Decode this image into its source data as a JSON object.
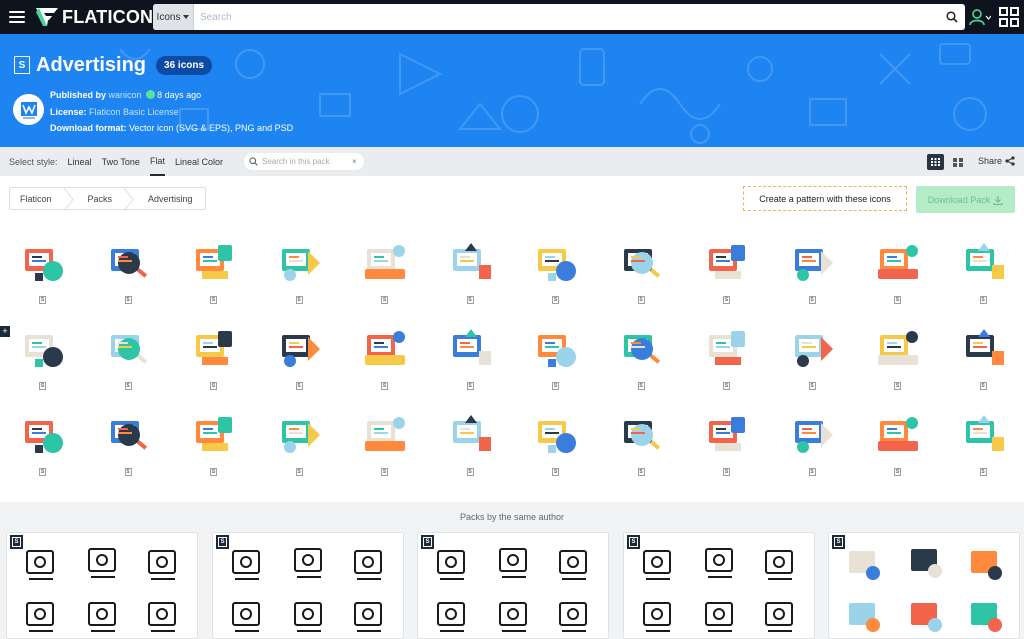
{
  "topbar": {
    "brand": "FLATICON",
    "search_select": "Icons",
    "search_placeholder": "Search"
  },
  "hero": {
    "title": "Advertising",
    "count": "36 icons",
    "published_label": "Published by",
    "author": "wanicon",
    "published_ago": "8 days ago",
    "license_label": "License:",
    "license_value": "Flaticon Basic License",
    "format_label": "Download format:",
    "format_value": "Vector icon (SVG & EPS), PNG and PSD"
  },
  "stylebar": {
    "label": "Select style:",
    "options": [
      "Lineal",
      "Two Tone",
      "Flat",
      "Lineal Color"
    ],
    "active": "Flat",
    "pack_search_placeholder": "Search in this pack",
    "share": "Share"
  },
  "breadcrumb": [
    "Flaticon",
    "Packs",
    "Advertising"
  ],
  "actions": {
    "pattern": "Create a pattern with these icons",
    "download": "Download Pack"
  },
  "icons": {
    "badge": "S",
    "rows": [
      [
        "monitor-ad",
        "search-person",
        "presenter-board",
        "newspapers",
        "chat-bubbles",
        "globe-speaker",
        "billboard",
        "products-shelf",
        "printer-banner",
        "audience-board",
        "scissors-coupon",
        "mail-ads"
      ],
      [
        "ad-papers",
        "gear-chart",
        "lightbulb-ad",
        "eye-target",
        "gift-tags",
        "marketing-team",
        "shop-front",
        "speaker-phone",
        "video-camera",
        "boxing-ring",
        "rating-badge",
        "megaphone-list"
      ],
      [
        "retro-tv",
        "mailbox",
        "kiosk-hand",
        "growth-chart",
        "magnet",
        "parking-sign",
        "drone-megaphone",
        "outdoor-screen",
        "ad-van",
        "clock-display",
        "hand-card",
        "phone-card"
      ]
    ]
  },
  "bottom": {
    "title": "Packs by the same author",
    "cards": [
      "family-pack",
      "ecommerce-pack",
      "education-pack",
      "summer-pack",
      "color-pack"
    ]
  }
}
